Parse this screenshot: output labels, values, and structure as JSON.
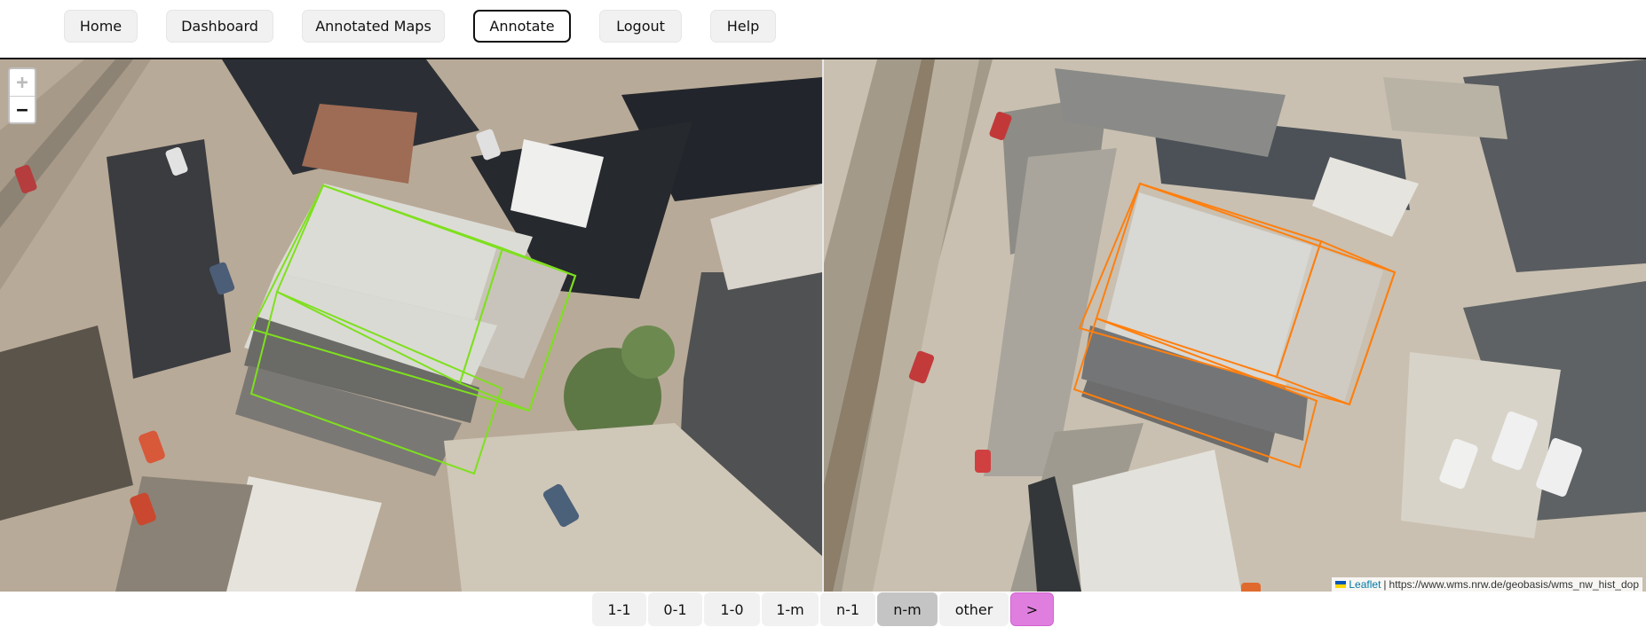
{
  "nav": {
    "items": [
      {
        "label": "Home"
      },
      {
        "label": "Dashboard"
      },
      {
        "label": "Annotated Maps"
      },
      {
        "label": "Annotate",
        "active": true
      },
      {
        "label": "Logout"
      },
      {
        "label": "Help"
      }
    ]
  },
  "maps": {
    "left": {
      "zoom_in": "+",
      "zoom_out": "−",
      "polygon_color": "#7ee01e"
    },
    "right": {
      "polygon_color": "#ff7f0e",
      "attribution": {
        "link_label": "Leaflet",
        "separator": "|",
        "source": "https://www.wms.nrw.de/geobasis/wms_nw_hist_dop"
      }
    }
  },
  "categories": {
    "options": [
      "1-1",
      "0-1",
      "1-0",
      "1-m",
      "n-1",
      "n-m",
      "other"
    ],
    "selected": "n-m",
    "next_label": ">"
  },
  "colors": {
    "selected_category": "#c4c4c4",
    "next_button": "#e07ee0"
  }
}
